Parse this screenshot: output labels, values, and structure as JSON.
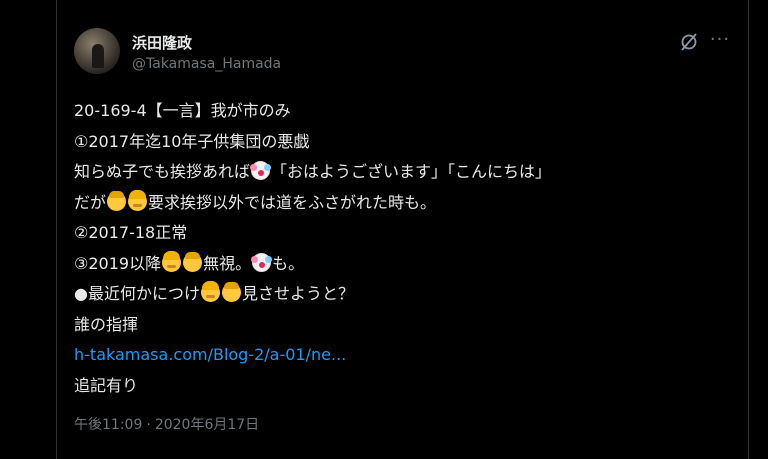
{
  "user": {
    "display_name": "浜田隆政",
    "handle": "@Takamasa_Hamada",
    "avatar": "avatar-photo"
  },
  "icons": {
    "grok": "grok-icon",
    "more": "more-options-icon"
  },
  "tweet": {
    "l1": "20-169-4【一言】我が市のみ",
    "l2": "①2017年迄10年子供集団の悪戯",
    "l3a": "知らぬ子でも挨拶あれば",
    "l3b": "「おはようございます」「こんにちは」",
    "l4a": "だが",
    "l4b": "要求挨拶以外では道をふさがれた時も。",
    "l5": "②2017-18正常",
    "l6a": "③2019以降",
    "l6b": "無視。",
    "l6c": "も。",
    "l7a": "●最近何かにつけ",
    "l7b": "見させようと？",
    "l8": "誰の指揮",
    "link": "h-takamasa.com/Blog-2/a-01/ne...",
    "l10": "追記有り"
  },
  "meta": {
    "time": "午後11:09",
    "separator": "·",
    "date": "2020年6月17日"
  },
  "colors": {
    "background": "#000000",
    "text": "#e7e9ea",
    "secondary": "#71767b",
    "link": "#1d9bf0",
    "border": "#2f3336"
  }
}
